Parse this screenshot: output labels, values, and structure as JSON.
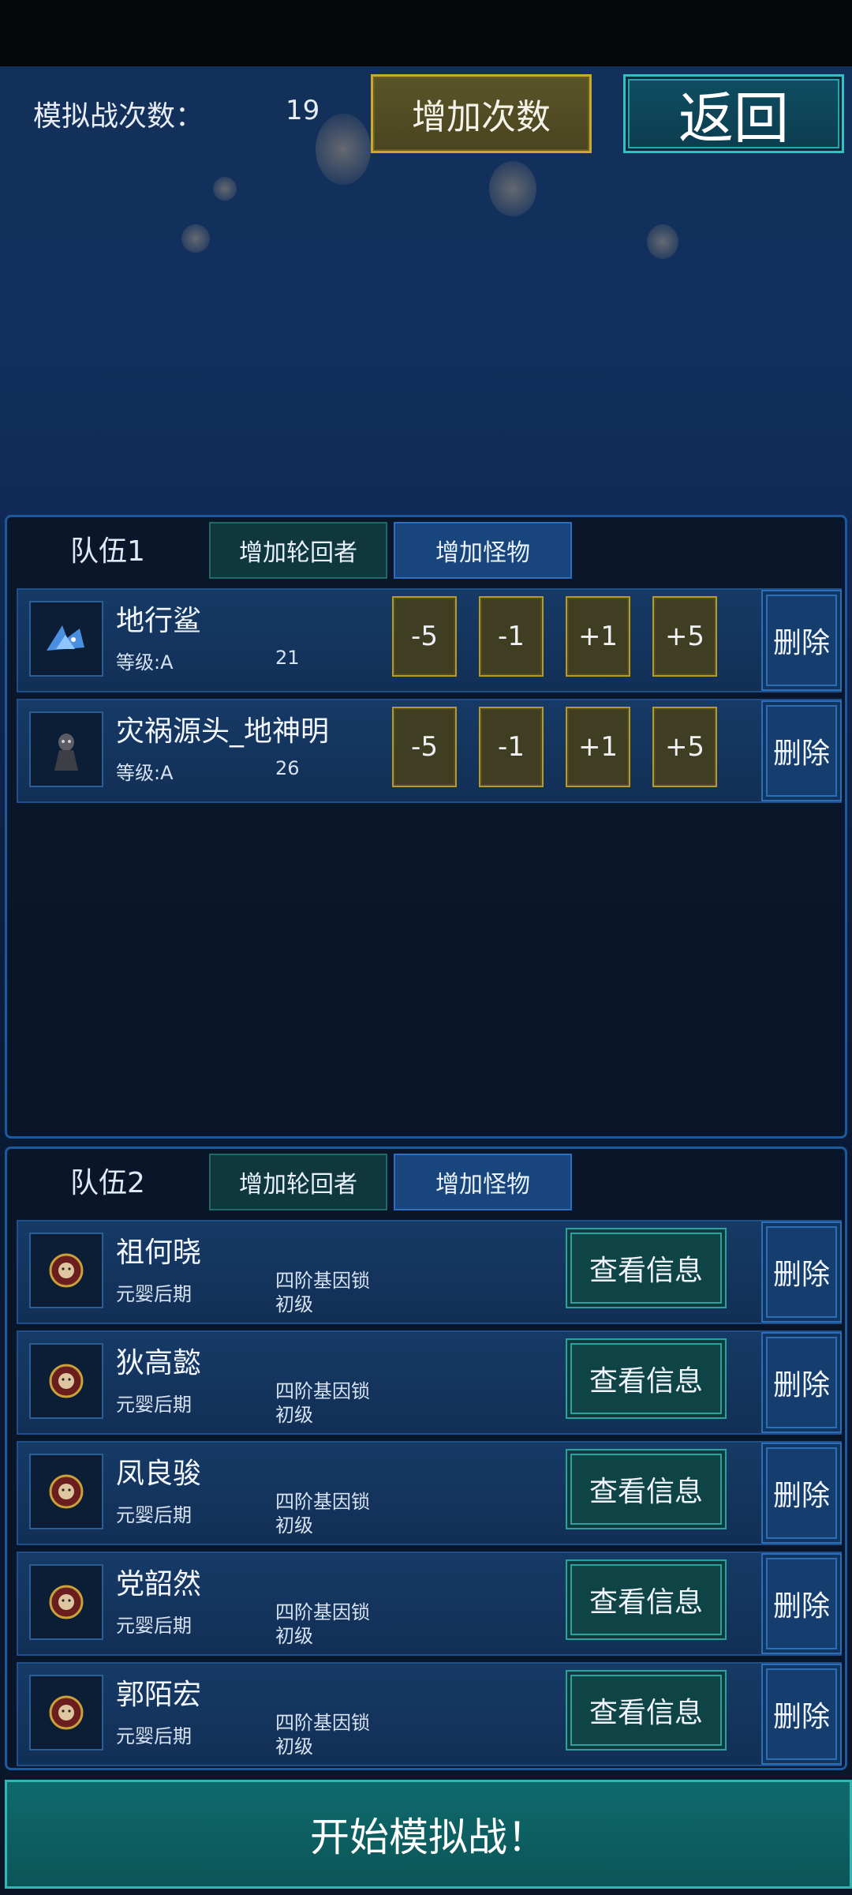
{
  "header": {
    "sim_label": "模拟战次数：",
    "sim_count": "19",
    "add_count_label": "增加次数",
    "back_label": "返回"
  },
  "team1": {
    "title": "队伍1",
    "tab_reincarnator": "增加轮回者",
    "tab_monster": "增加怪物",
    "rows": [
      {
        "name": "地行鲨",
        "rank": "等级:A",
        "count": "21",
        "minus5": "-5",
        "minus1": "-1",
        "plus1": "+1",
        "plus5": "+5",
        "delete": "删除"
      },
      {
        "name": "灾祸源头_地神明",
        "rank": "等级:A",
        "count": "26",
        "minus5": "-5",
        "minus1": "-1",
        "plus1": "+1",
        "plus5": "+5",
        "delete": "删除"
      }
    ]
  },
  "team2": {
    "title": "队伍2",
    "tab_reincarnator": "增加轮回者",
    "tab_monster": "增加怪物",
    "rows": [
      {
        "name": "祖何晓",
        "realm": "元婴后期",
        "gene": "四阶基因锁",
        "gene_level": "初级",
        "info": "查看信息",
        "delete": "删除"
      },
      {
        "name": "狄高懿",
        "realm": "元婴后期",
        "gene": "四阶基因锁",
        "gene_level": "初级",
        "info": "查看信息",
        "delete": "删除"
      },
      {
        "name": "凤良骏",
        "realm": "元婴后期",
        "gene": "四阶基因锁",
        "gene_level": "初级",
        "info": "查看信息",
        "delete": "删除"
      },
      {
        "name": "党韶然",
        "realm": "元婴后期",
        "gene": "四阶基因锁",
        "gene_level": "初级",
        "info": "查看信息",
        "delete": "删除"
      },
      {
        "name": "郭陌宏",
        "realm": "元婴后期",
        "gene": "四阶基因锁",
        "gene_level": "初级",
        "info": "查看信息",
        "delete": "删除"
      }
    ]
  },
  "footer": {
    "start_label": "开始模拟战！"
  },
  "icons": {
    "monster1": "shark-monster-icon",
    "monster2": "dark-deity-icon",
    "character": "character-portrait-icon"
  }
}
